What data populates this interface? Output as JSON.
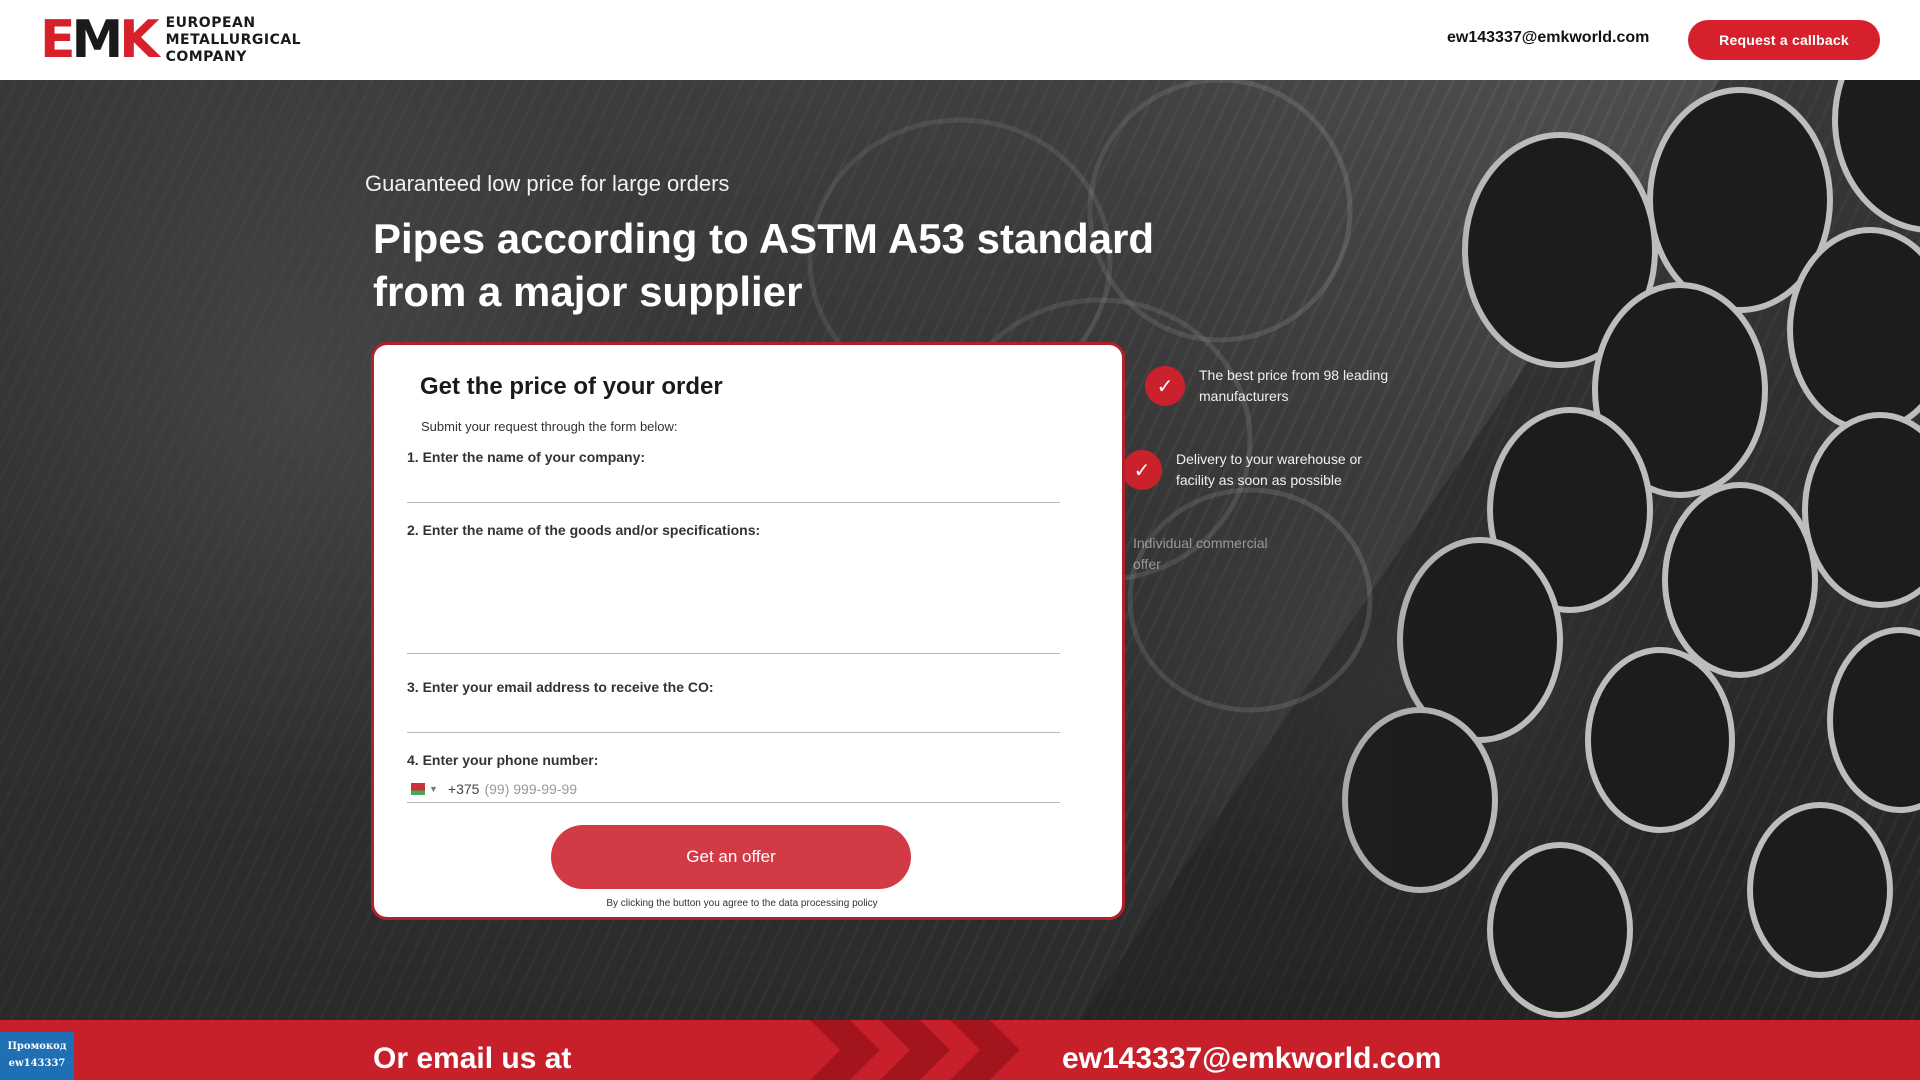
{
  "header": {
    "logo_mark": [
      "E",
      "M",
      "K"
    ],
    "logo_lines": [
      "EUROPEAN",
      "METALLURGICAL",
      "COMPANY"
    ],
    "email": "ew143337@emkworld.com",
    "callback_label": "Request a callback",
    "close_glyph": "×"
  },
  "hero": {
    "subtitle": "Guaranteed low price for large orders",
    "title": "Pipes according to ASTM A53 standard from a major supplier"
  },
  "form": {
    "title": "Get the price of your order",
    "description": "Submit your request through the form below:",
    "fields": [
      {
        "label": "1. Enter the name of your company:",
        "value": ""
      },
      {
        "label": "2. Enter the name of the goods and/or specifications:",
        "value": ""
      },
      {
        "label": "3. Enter your email address to receive the CO:",
        "value": ""
      },
      {
        "label": "4. Enter your phone number:",
        "value": ""
      }
    ],
    "phone_code": "+375",
    "phone_placeholder": "(99) 999-99-99",
    "submit_label": "Get an offer",
    "policy": "By clicking the button you agree to the data processing policy"
  },
  "benefits": [
    {
      "text": "The best price from 98 leading manufacturers"
    },
    {
      "text": "Delivery to your warehouse or facility as soon as possible"
    },
    {
      "text": "Individual commercial offer"
    }
  ],
  "bottom": {
    "left_text": "Or email us at",
    "email": "ew143337@emkworld.com"
  },
  "promo": {
    "line1": "Промокод",
    "line2": "ew143337"
  },
  "colors": {
    "brand_red": "#d6212c",
    "promo_blue": "#1f6fb5"
  },
  "icons": {
    "check": "check-icon",
    "close": "close-icon",
    "caret": "chevron-down-icon"
  }
}
